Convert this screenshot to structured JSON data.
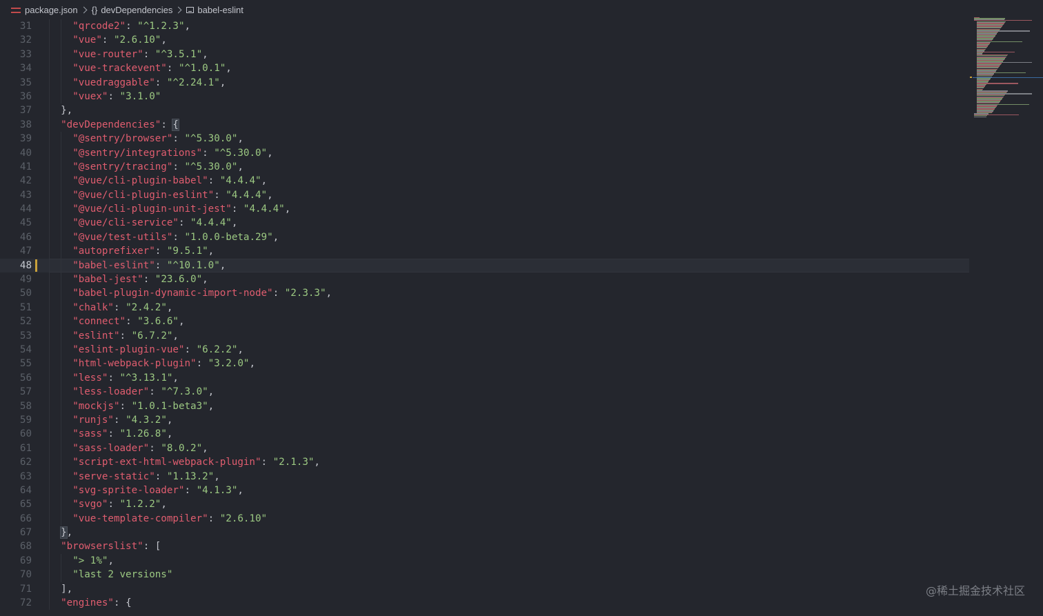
{
  "breadcrumb": {
    "file": "package.json",
    "section": "devDependencies",
    "item": "babel-eslint",
    "icons": [
      "json-file-icon",
      "braces-icon",
      "string-icon"
    ]
  },
  "editor": {
    "current_line": "48",
    "colors": {
      "background": "#24262d",
      "key": "#e05d6f",
      "string": "#9cc982",
      "line_number": "#5b6068",
      "modified_marker": "#c9a13b"
    }
  },
  "lines": [
    {
      "n": "31",
      "key": "\"qrcode2\"",
      "sep": ": ",
      "val": "\"^1.2.3\"",
      "end": ","
    },
    {
      "n": "32",
      "key": "\"vue\"",
      "sep": ": ",
      "val": "\"2.6.10\"",
      "end": ","
    },
    {
      "n": "33",
      "key": "\"vue-router\"",
      "sep": ": ",
      "val": "\"^3.5.1\"",
      "end": ","
    },
    {
      "n": "34",
      "key": "\"vue-trackevent\"",
      "sep": ": ",
      "val": "\"^1.0.1\"",
      "end": ","
    },
    {
      "n": "35",
      "key": "\"vuedraggable\"",
      "sep": ": ",
      "val": "\"^2.24.1\"",
      "end": ","
    },
    {
      "n": "36",
      "key": "\"vuex\"",
      "sep": ": ",
      "val": "\"3.1.0\"",
      "end": ""
    },
    {
      "n": "37",
      "text": "},"
    },
    {
      "n": "38",
      "key": "\"devDependencies\"",
      "sep": ": ",
      "open": "{"
    },
    {
      "n": "39",
      "key": "\"@sentry/browser\"",
      "sep": ": ",
      "val": "\"^5.30.0\"",
      "end": ","
    },
    {
      "n": "40",
      "key": "\"@sentry/integrations\"",
      "sep": ": ",
      "val": "\"^5.30.0\"",
      "end": ","
    },
    {
      "n": "41",
      "key": "\"@sentry/tracing\"",
      "sep": ": ",
      "val": "\"^5.30.0\"",
      "end": ","
    },
    {
      "n": "42",
      "key": "\"@vue/cli-plugin-babel\"",
      "sep": ": ",
      "val": "\"4.4.4\"",
      "end": ","
    },
    {
      "n": "43",
      "key": "\"@vue/cli-plugin-eslint\"",
      "sep": ": ",
      "val": "\"4.4.4\"",
      "end": ","
    },
    {
      "n": "44",
      "key": "\"@vue/cli-plugin-unit-jest\"",
      "sep": ": ",
      "val": "\"4.4.4\"",
      "end": ","
    },
    {
      "n": "45",
      "key": "\"@vue/cli-service\"",
      "sep": ": ",
      "val": "\"4.4.4\"",
      "end": ","
    },
    {
      "n": "46",
      "key": "\"@vue/test-utils\"",
      "sep": ": ",
      "val": "\"1.0.0-beta.29\"",
      "end": ","
    },
    {
      "n": "47",
      "key": "\"autoprefixer\"",
      "sep": ": ",
      "val": "\"9.5.1\"",
      "end": ","
    },
    {
      "n": "48",
      "key": "\"babel-eslint\"",
      "sep": ": ",
      "val": "\"^10.1.0\"",
      "end": ","
    },
    {
      "n": "49",
      "key": "\"babel-jest\"",
      "sep": ": ",
      "val": "\"23.6.0\"",
      "end": ","
    },
    {
      "n": "50",
      "key": "\"babel-plugin-dynamic-import-node\"",
      "sep": ": ",
      "val": "\"2.3.3\"",
      "end": ","
    },
    {
      "n": "51",
      "key": "\"chalk\"",
      "sep": ": ",
      "val": "\"2.4.2\"",
      "end": ","
    },
    {
      "n": "52",
      "key": "\"connect\"",
      "sep": ": ",
      "val": "\"3.6.6\"",
      "end": ","
    },
    {
      "n": "53",
      "key": "\"eslint\"",
      "sep": ": ",
      "val": "\"6.7.2\"",
      "end": ","
    },
    {
      "n": "54",
      "key": "\"eslint-plugin-vue\"",
      "sep": ": ",
      "val": "\"6.2.2\"",
      "end": ","
    },
    {
      "n": "55",
      "key": "\"html-webpack-plugin\"",
      "sep": ": ",
      "val": "\"3.2.0\"",
      "end": ","
    },
    {
      "n": "56",
      "key": "\"less\"",
      "sep": ": ",
      "val": "\"^3.13.1\"",
      "end": ","
    },
    {
      "n": "57",
      "key": "\"less-loader\"",
      "sep": ": ",
      "val": "\"^7.3.0\"",
      "end": ","
    },
    {
      "n": "58",
      "key": "\"mockjs\"",
      "sep": ": ",
      "val": "\"1.0.1-beta3\"",
      "end": ","
    },
    {
      "n": "59",
      "key": "\"runjs\"",
      "sep": ": ",
      "val": "\"4.3.2\"",
      "end": ","
    },
    {
      "n": "60",
      "key": "\"sass\"",
      "sep": ": ",
      "val": "\"1.26.8\"",
      "end": ","
    },
    {
      "n": "61",
      "key": "\"sass-loader\"",
      "sep": ": ",
      "val": "\"8.0.2\"",
      "end": ","
    },
    {
      "n": "62",
      "key": "\"script-ext-html-webpack-plugin\"",
      "sep": ": ",
      "val": "\"2.1.3\"",
      "end": ","
    },
    {
      "n": "63",
      "key": "\"serve-static\"",
      "sep": ": ",
      "val": "\"1.13.2\"",
      "end": ","
    },
    {
      "n": "64",
      "key": "\"svg-sprite-loader\"",
      "sep": ": ",
      "val": "\"4.1.3\"",
      "end": ","
    },
    {
      "n": "65",
      "key": "\"svgo\"",
      "sep": ": ",
      "val": "\"1.2.2\"",
      "end": ","
    },
    {
      "n": "66",
      "key": "\"vue-template-compiler\"",
      "sep": ": ",
      "val": "\"2.6.10\"",
      "end": ""
    },
    {
      "n": "67",
      "close": "}",
      "end": ","
    },
    {
      "n": "68",
      "key": "\"browserslist\"",
      "sep": ": ",
      "open": "["
    },
    {
      "n": "69",
      "val": "\"> 1%\"",
      "end": ","
    },
    {
      "n": "70",
      "val": "\"last 2 versions\"",
      "end": ""
    },
    {
      "n": "71",
      "text": "],"
    },
    {
      "n": "72",
      "key": "\"engines\"",
      "sep": ": ",
      "open": "{"
    }
  ],
  "watermark": "@稀土掘金技术社区"
}
